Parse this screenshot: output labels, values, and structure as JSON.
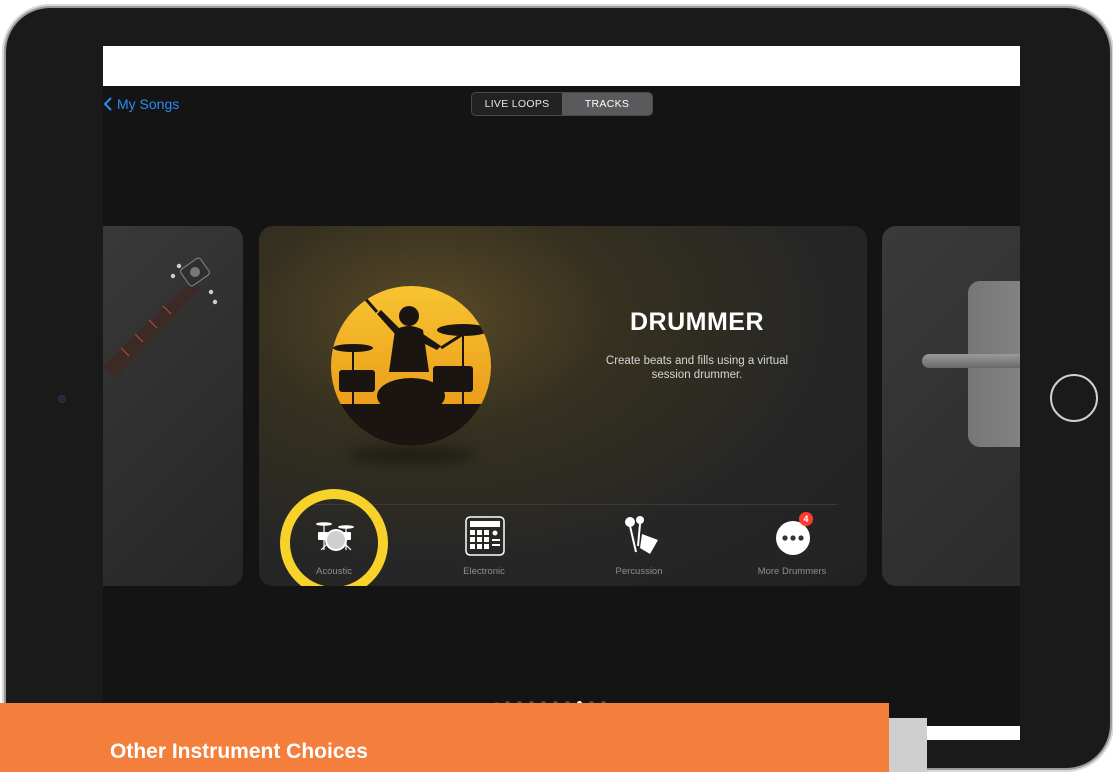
{
  "navigation": {
    "back_label": "My Songs"
  },
  "mode_switch": {
    "options": [
      {
        "label": "LIVE LOOPS",
        "selected": false
      },
      {
        "label": "TRACKS",
        "selected": true
      }
    ]
  },
  "instrument": {
    "title": "DRUMMER",
    "description": "Create beats and fills using a virtual session drummer.",
    "options": [
      {
        "label": "Acoustic",
        "icon": "acoustic-drum-kit-icon",
        "highlighted": true
      },
      {
        "label": "Electronic",
        "icon": "drum-pad-icon"
      },
      {
        "label": "Percussion",
        "icon": "percussion-icon"
      },
      {
        "label": "More Drummers",
        "icon": "more-icon",
        "badge": "4"
      }
    ]
  },
  "pagination": {
    "total": 10,
    "active_index": 7
  },
  "caption": {
    "text": "Other Instrument Choices"
  },
  "colors": {
    "accent_blue": "#2b8cf2",
    "highlight_yellow": "#f7d22a",
    "caption_orange": "#f47f3c",
    "badge_red": "#ff3b30"
  }
}
